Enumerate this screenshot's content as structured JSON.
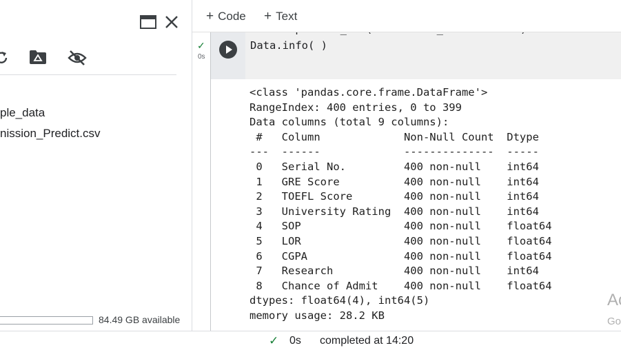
{
  "left_panel": {
    "files": [
      {
        "name": "ple_data"
      },
      {
        "name": "nission_Predict.csv"
      }
    ],
    "disk": {
      "label": "84.49 GB available"
    }
  },
  "toolbar": {
    "add_code_label": "Code",
    "add_text_label": "Text"
  },
  "cell": {
    "exec_time": "0s",
    "code_lines": [
      "Data = pd.read_csv('Admission_Predict.csv')",
      "Data.info( )"
    ],
    "output_lines": [
      "<class 'pandas.core.frame.DataFrame'>",
      "RangeIndex: 400 entries, 0 to 399",
      "Data columns (total 9 columns):",
      " #   Column             Non-Null Count  Dtype  ",
      "---  ------             --------------  -----  ",
      " 0   Serial No.         400 non-null    int64  ",
      " 1   GRE Score          400 non-null    int64  ",
      " 2   TOEFL Score        400 non-null    int64  ",
      " 3   University Rating  400 non-null    int64  ",
      " 4   SOP                400 non-null    float64",
      " 5   LOR                400 non-null    float64",
      " 6   CGPA               400 non-null    float64",
      " 7   Research           400 non-null    int64  ",
      " 8   Chance of Admit    400 non-null    float64",
      "dtypes: float64(4), int64(5)",
      "memory usage: 28.2 KB"
    ]
  },
  "statusbar": {
    "time": "0s",
    "text": "completed at 14:20"
  },
  "watermark": {
    "line1": "Ac",
    "line2": "Go"
  },
  "colors": {
    "success": "#188038",
    "run_button": "#3c4043",
    "code_bg": "#f0f0f0"
  }
}
